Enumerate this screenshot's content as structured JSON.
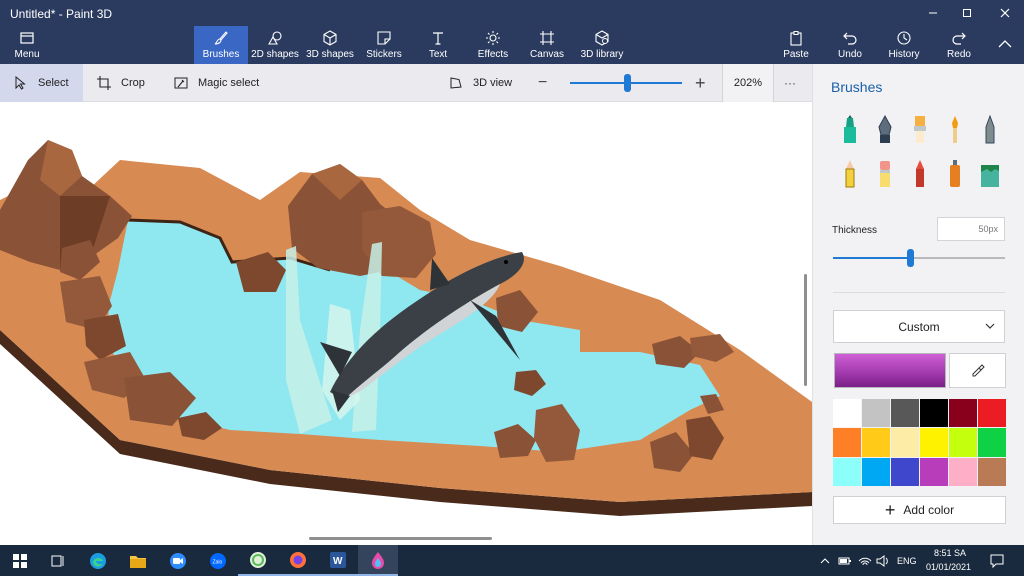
{
  "window": {
    "title": "Untitled* - Paint 3D",
    "controls": [
      "minimize",
      "maximize",
      "close"
    ]
  },
  "ribbon": {
    "menu_label": "Menu",
    "tabs": [
      {
        "label": "Brushes",
        "icon": "brush-icon",
        "active": true
      },
      {
        "label": "2D shapes",
        "icon": "2d-shapes-icon"
      },
      {
        "label": "3D shapes",
        "icon": "cube-icon"
      },
      {
        "label": "Stickers",
        "icon": "sticker-icon"
      },
      {
        "label": "Text",
        "icon": "text-icon"
      },
      {
        "label": "Effects",
        "icon": "sun-icon"
      },
      {
        "label": "Canvas",
        "icon": "canvas-icon"
      },
      {
        "label": "3D library",
        "icon": "library-icon"
      }
    ],
    "right": [
      {
        "label": "Paste",
        "icon": "clipboard-icon"
      },
      {
        "label": "Undo",
        "icon": "undo-icon"
      },
      {
        "label": "History",
        "icon": "history-icon"
      },
      {
        "label": "Redo",
        "icon": "redo-icon"
      }
    ]
  },
  "toolbar": {
    "select_label": "Select",
    "crop_label": "Crop",
    "magic_select_label": "Magic select",
    "view3d_label": "3D view",
    "zoom_value": "202%",
    "zoom_minus": "−",
    "zoom_plus": "+",
    "more": "···"
  },
  "panel": {
    "title": "Brushes",
    "brushes": [
      "marker",
      "calligraphy-pen",
      "oil-brush",
      "watercolor",
      "pixel-pen",
      "pencil",
      "eraser",
      "crayon",
      "spray-can",
      "fill"
    ],
    "thickness_label": "Thickness",
    "thickness_value": "50px",
    "thickness_percent": 45,
    "finish_label": "Custom",
    "current_color": "#a43bb0",
    "palette": [
      "#ffffff",
      "#c3c3c3",
      "#585858",
      "#000000",
      "#88001b",
      "#ec1c24",
      "#ff7f27",
      "#ffca18",
      "#fdeca6",
      "#fff200",
      "#c4ff0e",
      "#0ed145",
      "#8cfffb",
      "#00a8f3",
      "#3f48cc",
      "#b83dba",
      "#ffaec8",
      "#b97a56"
    ],
    "add_color_label": "Add color"
  },
  "taskbar": {
    "apps": [
      "windows-start",
      "task-view",
      "edge",
      "file-explorer",
      "zoom",
      "zalo",
      "pic-editor",
      "firefox",
      "word",
      "paint-3d"
    ],
    "language": "ENG",
    "time": "8:51 SA",
    "date": "01/01/2021"
  },
  "colors": {
    "title_bar": "#2b3b5f",
    "accent": "#3a66c4",
    "taskbar": "#1a2a3e"
  }
}
